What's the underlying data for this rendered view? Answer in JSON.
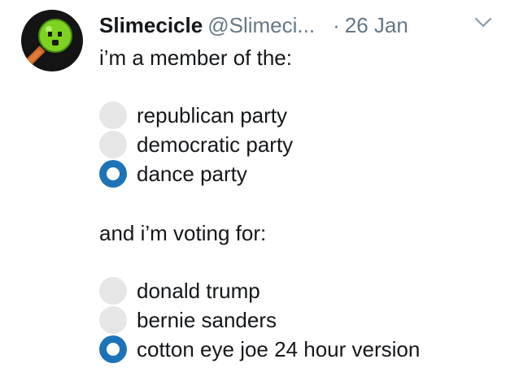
{
  "tweet": {
    "display_name": "Slimecicle",
    "handle": "@Slimeci...",
    "separator": "·",
    "date": "26 Jan",
    "intro": "i’m a member of the:",
    "party_options": [
      {
        "label": "republican party",
        "selected": false
      },
      {
        "label": "democratic party",
        "selected": false
      },
      {
        "label": "dance party",
        "selected": true
      }
    ],
    "second_prompt": "and i’m voting for:",
    "vote_options": [
      {
        "label": "donald trump",
        "selected": false
      },
      {
        "label": "bernie sanders",
        "selected": false
      },
      {
        "label": "cotton eye joe 24 hour version",
        "selected": true
      }
    ]
  },
  "colors": {
    "radio_selected": "#1d73b8",
    "radio_unselected": "#e6e6e6",
    "secondary_text": "#657786",
    "avatar_slime": "#7ed321"
  },
  "icons": {
    "avatar": "slime-on-stick-avatar",
    "menu": "chevron-down-icon"
  }
}
